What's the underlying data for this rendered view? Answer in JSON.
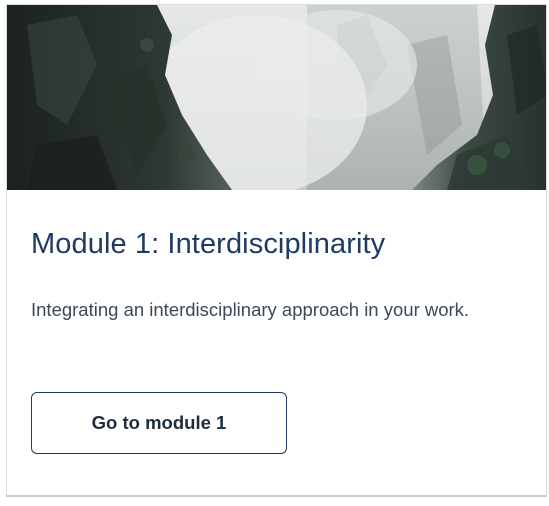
{
  "card": {
    "title": "Module 1: Interdisciplinarity",
    "description": "Integrating an interdisciplinary approach in your work.",
    "button_label": "Go to module 1"
  },
  "colors": {
    "title": "#1f3b64",
    "text": "#3b4a58",
    "button_border": "#1f3b64"
  }
}
